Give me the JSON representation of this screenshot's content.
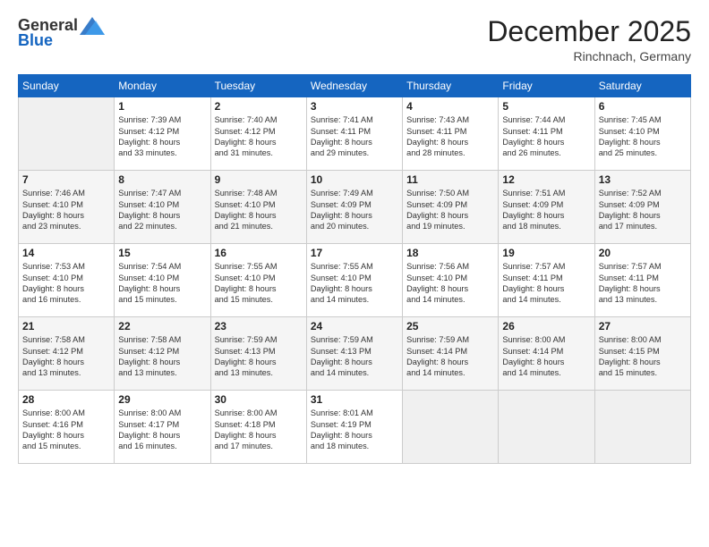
{
  "header": {
    "logo_general": "General",
    "logo_blue": "Blue",
    "month_title": "December 2025",
    "location": "Rinchnach, Germany"
  },
  "weekdays": [
    "Sunday",
    "Monday",
    "Tuesday",
    "Wednesday",
    "Thursday",
    "Friday",
    "Saturday"
  ],
  "weeks": [
    [
      {
        "day": "",
        "info": ""
      },
      {
        "day": "1",
        "info": "Sunrise: 7:39 AM\nSunset: 4:12 PM\nDaylight: 8 hours\nand 33 minutes."
      },
      {
        "day": "2",
        "info": "Sunrise: 7:40 AM\nSunset: 4:12 PM\nDaylight: 8 hours\nand 31 minutes."
      },
      {
        "day": "3",
        "info": "Sunrise: 7:41 AM\nSunset: 4:11 PM\nDaylight: 8 hours\nand 29 minutes."
      },
      {
        "day": "4",
        "info": "Sunrise: 7:43 AM\nSunset: 4:11 PM\nDaylight: 8 hours\nand 28 minutes."
      },
      {
        "day": "5",
        "info": "Sunrise: 7:44 AM\nSunset: 4:11 PM\nDaylight: 8 hours\nand 26 minutes."
      },
      {
        "day": "6",
        "info": "Sunrise: 7:45 AM\nSunset: 4:10 PM\nDaylight: 8 hours\nand 25 minutes."
      }
    ],
    [
      {
        "day": "7",
        "info": "Sunrise: 7:46 AM\nSunset: 4:10 PM\nDaylight: 8 hours\nand 23 minutes."
      },
      {
        "day": "8",
        "info": "Sunrise: 7:47 AM\nSunset: 4:10 PM\nDaylight: 8 hours\nand 22 minutes."
      },
      {
        "day": "9",
        "info": "Sunrise: 7:48 AM\nSunset: 4:10 PM\nDaylight: 8 hours\nand 21 minutes."
      },
      {
        "day": "10",
        "info": "Sunrise: 7:49 AM\nSunset: 4:09 PM\nDaylight: 8 hours\nand 20 minutes."
      },
      {
        "day": "11",
        "info": "Sunrise: 7:50 AM\nSunset: 4:09 PM\nDaylight: 8 hours\nand 19 minutes."
      },
      {
        "day": "12",
        "info": "Sunrise: 7:51 AM\nSunset: 4:09 PM\nDaylight: 8 hours\nand 18 minutes."
      },
      {
        "day": "13",
        "info": "Sunrise: 7:52 AM\nSunset: 4:09 PM\nDaylight: 8 hours\nand 17 minutes."
      }
    ],
    [
      {
        "day": "14",
        "info": "Sunrise: 7:53 AM\nSunset: 4:10 PM\nDaylight: 8 hours\nand 16 minutes."
      },
      {
        "day": "15",
        "info": "Sunrise: 7:54 AM\nSunset: 4:10 PM\nDaylight: 8 hours\nand 15 minutes."
      },
      {
        "day": "16",
        "info": "Sunrise: 7:55 AM\nSunset: 4:10 PM\nDaylight: 8 hours\nand 15 minutes."
      },
      {
        "day": "17",
        "info": "Sunrise: 7:55 AM\nSunset: 4:10 PM\nDaylight: 8 hours\nand 14 minutes."
      },
      {
        "day": "18",
        "info": "Sunrise: 7:56 AM\nSunset: 4:10 PM\nDaylight: 8 hours\nand 14 minutes."
      },
      {
        "day": "19",
        "info": "Sunrise: 7:57 AM\nSunset: 4:11 PM\nDaylight: 8 hours\nand 14 minutes."
      },
      {
        "day": "20",
        "info": "Sunrise: 7:57 AM\nSunset: 4:11 PM\nDaylight: 8 hours\nand 13 minutes."
      }
    ],
    [
      {
        "day": "21",
        "info": "Sunrise: 7:58 AM\nSunset: 4:12 PM\nDaylight: 8 hours\nand 13 minutes."
      },
      {
        "day": "22",
        "info": "Sunrise: 7:58 AM\nSunset: 4:12 PM\nDaylight: 8 hours\nand 13 minutes."
      },
      {
        "day": "23",
        "info": "Sunrise: 7:59 AM\nSunset: 4:13 PM\nDaylight: 8 hours\nand 13 minutes."
      },
      {
        "day": "24",
        "info": "Sunrise: 7:59 AM\nSunset: 4:13 PM\nDaylight: 8 hours\nand 14 minutes."
      },
      {
        "day": "25",
        "info": "Sunrise: 7:59 AM\nSunset: 4:14 PM\nDaylight: 8 hours\nand 14 minutes."
      },
      {
        "day": "26",
        "info": "Sunrise: 8:00 AM\nSunset: 4:14 PM\nDaylight: 8 hours\nand 14 minutes."
      },
      {
        "day": "27",
        "info": "Sunrise: 8:00 AM\nSunset: 4:15 PM\nDaylight: 8 hours\nand 15 minutes."
      }
    ],
    [
      {
        "day": "28",
        "info": "Sunrise: 8:00 AM\nSunset: 4:16 PM\nDaylight: 8 hours\nand 15 minutes."
      },
      {
        "day": "29",
        "info": "Sunrise: 8:00 AM\nSunset: 4:17 PM\nDaylight: 8 hours\nand 16 minutes."
      },
      {
        "day": "30",
        "info": "Sunrise: 8:00 AM\nSunset: 4:18 PM\nDaylight: 8 hours\nand 17 minutes."
      },
      {
        "day": "31",
        "info": "Sunrise: 8:01 AM\nSunset: 4:19 PM\nDaylight: 8 hours\nand 18 minutes."
      },
      {
        "day": "",
        "info": ""
      },
      {
        "day": "",
        "info": ""
      },
      {
        "day": "",
        "info": ""
      }
    ]
  ]
}
